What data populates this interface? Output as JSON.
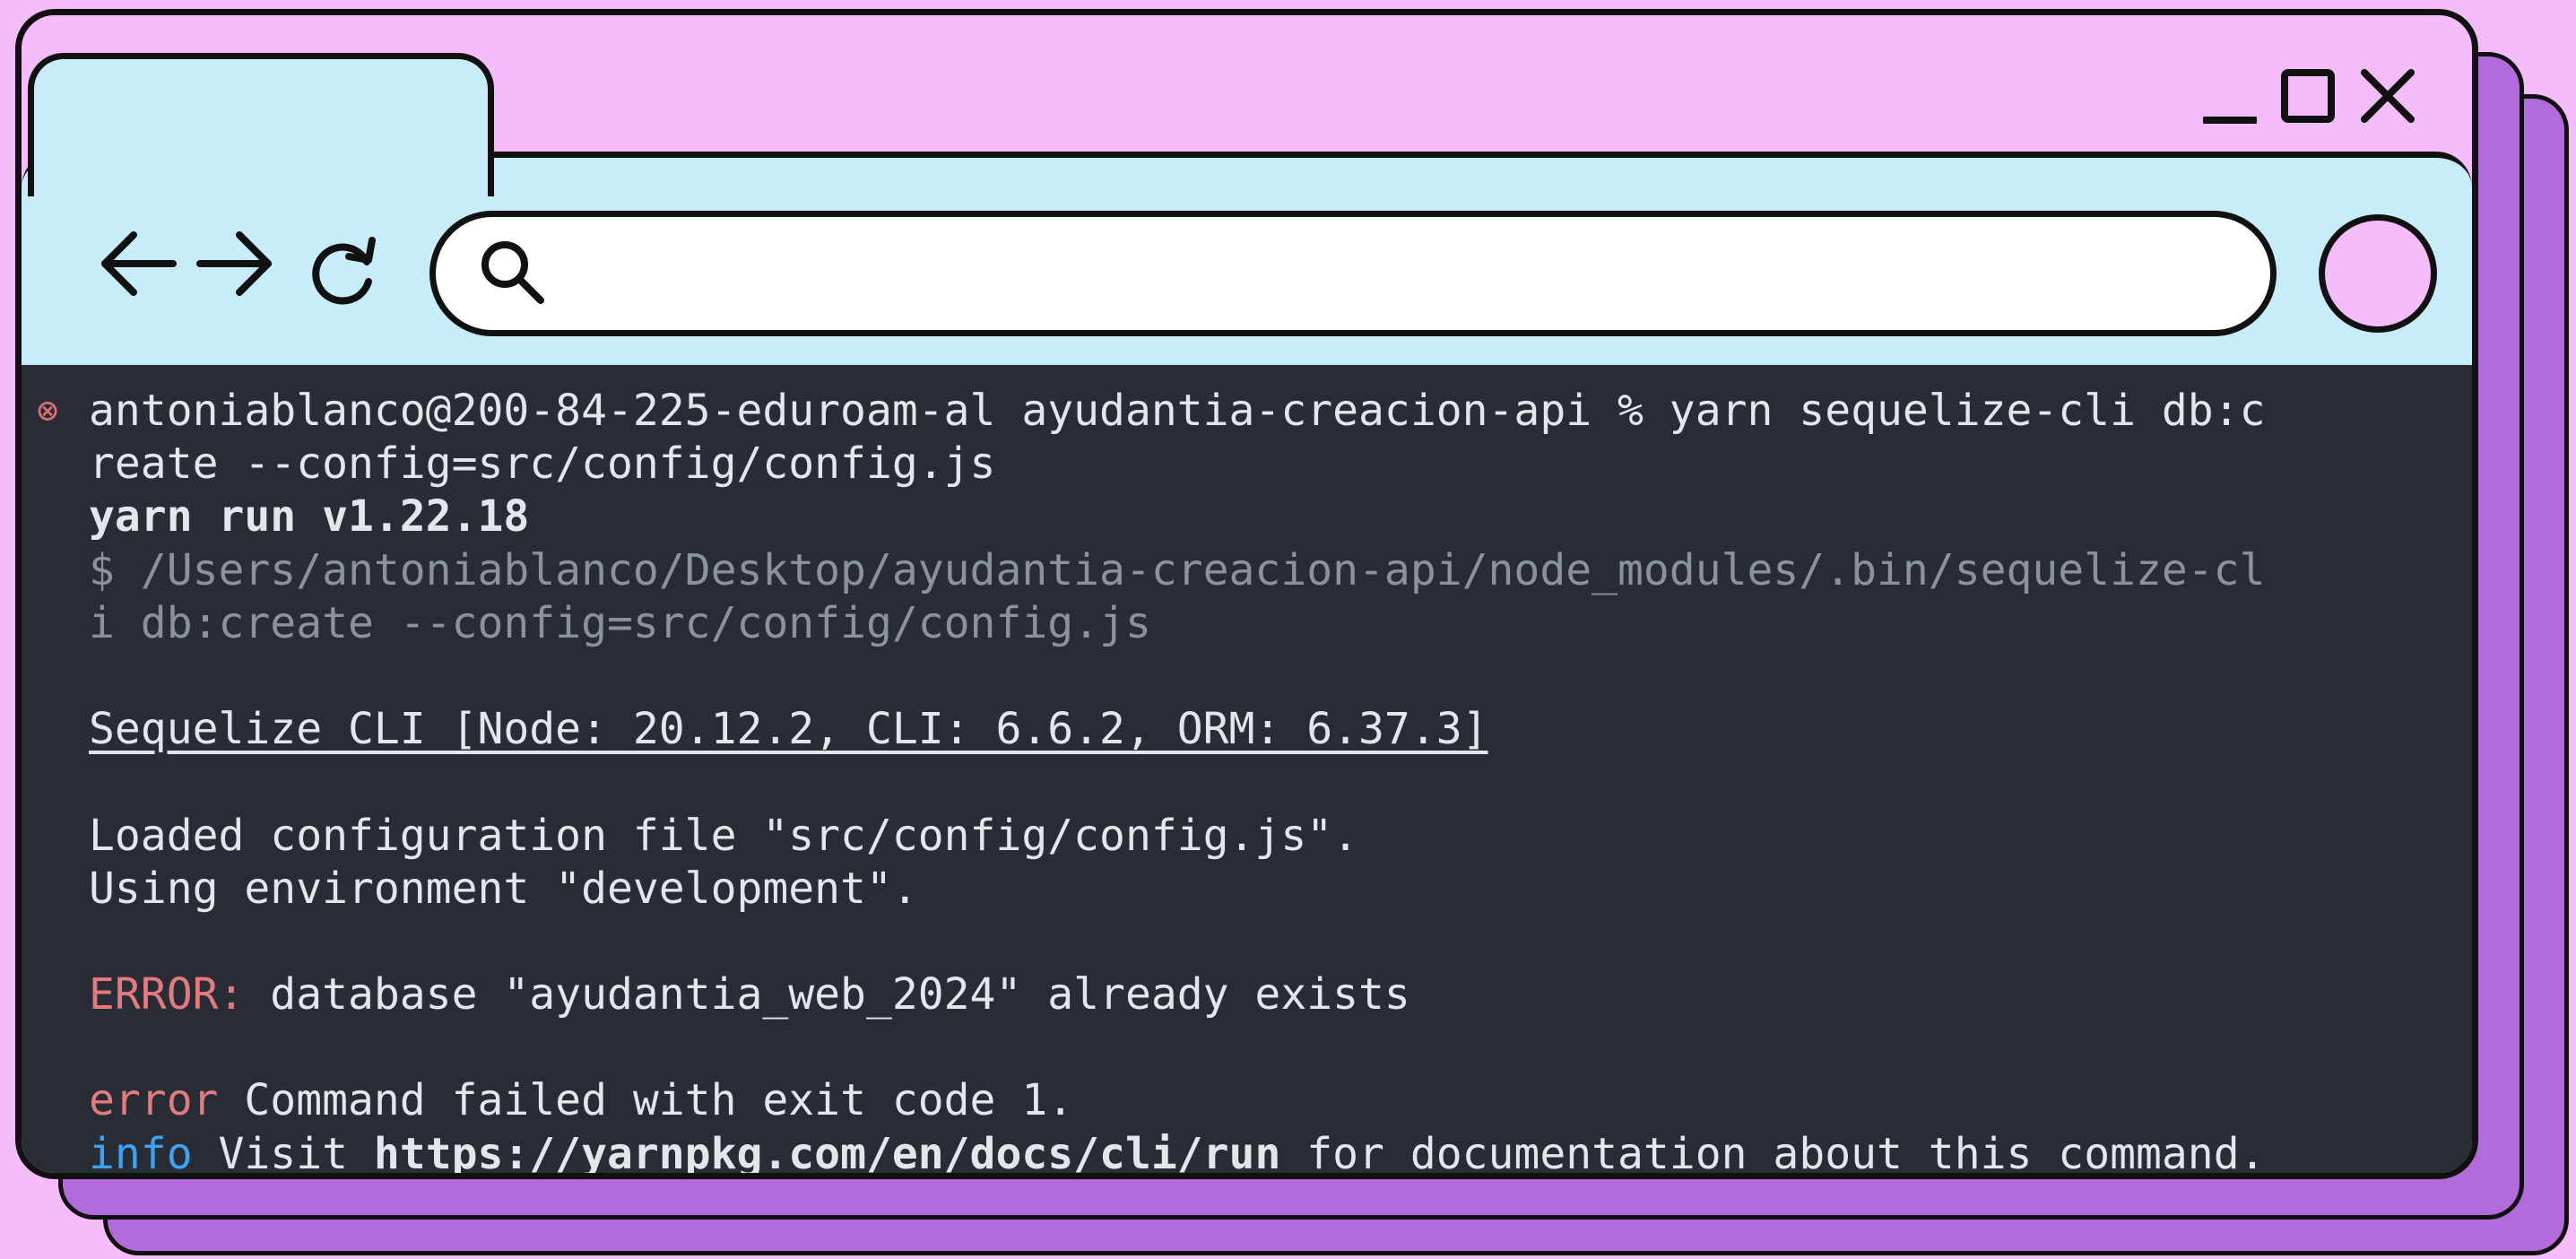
{
  "terminal": {
    "lines": [
      {
        "kind": "prompt",
        "marker": "⊗",
        "text": "antoniablanco@200-84-225-eduroam-al ayudantia-creacion-api % yarn sequelize-cli db:c"
      },
      {
        "kind": "normal",
        "text": "reate --config=src/config/config.js"
      },
      {
        "kind": "bold",
        "text": "yarn run v1.22.18"
      },
      {
        "kind": "dim",
        "text": "$ /Users/antoniablanco/Desktop/ayudantia-creacion-api/node_modules/.bin/sequelize-cl"
      },
      {
        "kind": "dim",
        "text": "i db:create --config=src/config/config.js"
      },
      {
        "kind": "blank",
        "text": ""
      },
      {
        "kind": "underline",
        "text": "Sequelize CLI [Node: 20.12.2, CLI: 6.6.2, ORM: 6.37.3]"
      },
      {
        "kind": "blank",
        "text": ""
      },
      {
        "kind": "normal",
        "text": "Loaded configuration file \"src/config/config.js\"."
      },
      {
        "kind": "normal",
        "text": "Using environment \"development\"."
      },
      {
        "kind": "blank",
        "text": ""
      },
      {
        "kind": "error",
        "label": "ERROR:",
        "text": " database \"ayudantia_web_2024\" already exists"
      },
      {
        "kind": "blank",
        "text": ""
      },
      {
        "kind": "yarn-error",
        "label": "error",
        "text": " Command failed with exit code 1."
      },
      {
        "kind": "info",
        "label": "info",
        "text": " Visit ",
        "link": "https://yarnpkg.com/en/docs/cli/run",
        "suffix": " for documentation about this command."
      }
    ]
  },
  "colors": {
    "page_bg": "#f5bcfb",
    "chrome_bg": "#c7edfb",
    "terminal_bg": "#272c35",
    "error_red": "#e27a7e",
    "info_blue": "#3ea2f0",
    "shadow_purple": "#b36bdb"
  },
  "icons": {
    "back": "arrow-left-icon",
    "forward": "arrow-right-icon",
    "reload": "reload-icon",
    "search": "search-icon",
    "minimize": "minimize-icon",
    "maximize": "maximize-icon",
    "close": "close-icon"
  }
}
